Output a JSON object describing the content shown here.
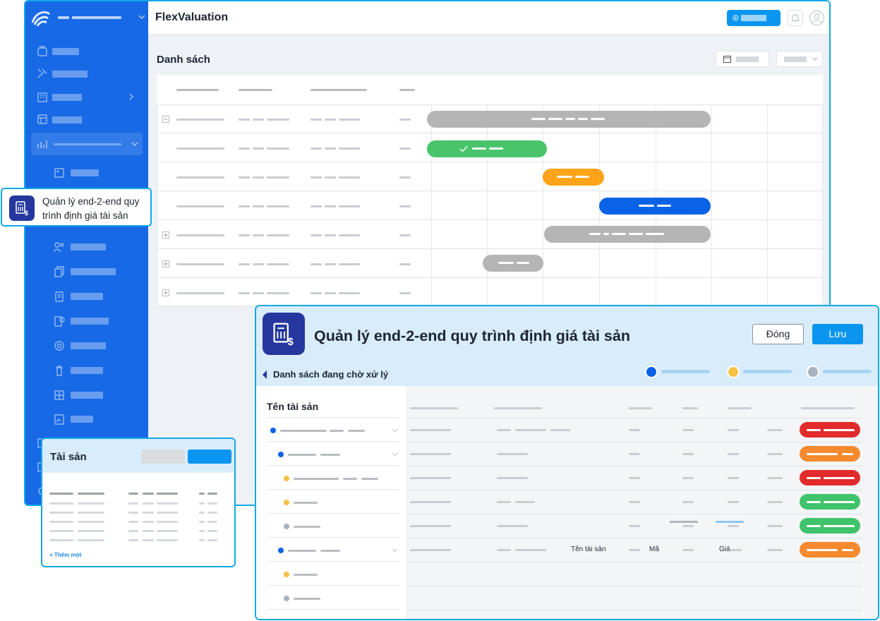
{
  "app": {
    "title": "FlexValuation"
  },
  "main": {
    "section_title": "Danh sách"
  },
  "callout": {
    "label_line1": "Quản lý end-2-end quy",
    "label_line2": "trình định giá tài sản"
  },
  "modal": {
    "title": "Quản lý end-2-end quy trình định giá tài sản",
    "close_label": "Đóng",
    "save_label": "Lưu",
    "back_label": "Danh sách đang chờ xử lý",
    "tree_header": "Tên tài sản",
    "row_labels": {
      "name": "Tên tài sản",
      "code": "Mã",
      "price": "Giá"
    },
    "steps": [
      {
        "color": "#0a63e6"
      },
      {
        "color": "#f7c244"
      },
      {
        "color": "#a9b1bd"
      }
    ]
  },
  "card": {
    "title": "Tài sản",
    "add_label": "+ Thêm mới"
  },
  "colors": {
    "brand_blue": "#1769e6",
    "accent_cyan": "#12a9e8",
    "button_blue": "#0a96f0",
    "gantt_gray": "#b5b5b5",
    "gantt_green": "#49c46a",
    "gantt_orange": "#ffa318",
    "gantt_blue": "#0a63e6",
    "status_red": "#e12b2b",
    "status_orange": "#f58a2f",
    "status_green": "#3fc36a"
  },
  "icons": [
    "logo-icon",
    "bell-icon",
    "user-avatar-icon",
    "calendar-icon",
    "chevron-down-icon",
    "chevron-right-icon",
    "chevron-left-icon",
    "valuation-doc-icon",
    "expand-icon",
    "collapse-icon",
    "check-icon"
  ]
}
